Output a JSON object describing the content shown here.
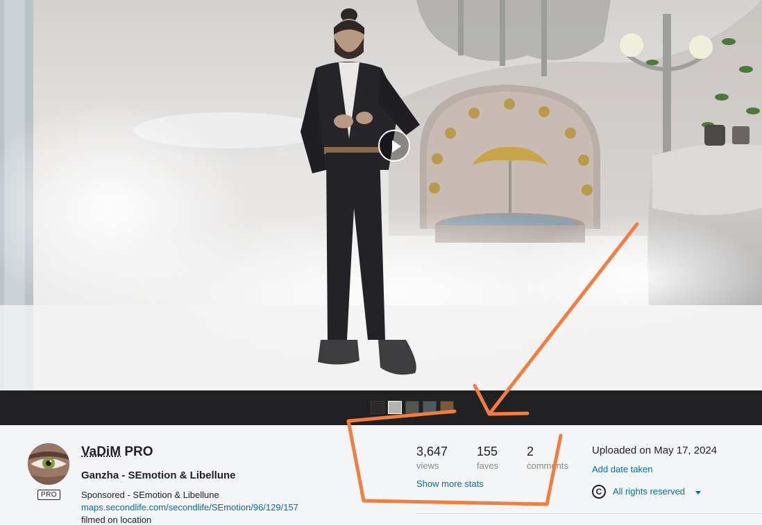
{
  "owner": {
    "name": "VaDiM",
    "badge": "PRO",
    "pro_badge": "PRO"
  },
  "photo": {
    "title": "Ganzha - SEmotion & Libellune",
    "description": {
      "line1": "Sponsored - SEmotion & Libellune",
      "link": "maps.secondlife.com/secondlife/SEmotion/96/129/157",
      "line3": "filmed on location"
    }
  },
  "stats": [
    {
      "value": "3,647",
      "label": "views"
    },
    {
      "value": "155",
      "label": "faves"
    },
    {
      "value": "2",
      "label": "comments"
    }
  ],
  "show_more_stats": "Show more stats",
  "uploaded": "Uploaded on May 17, 2024",
  "add_date_taken": "Add date taken",
  "license": {
    "icon": "C",
    "label": "All rights reserved"
  },
  "filmstrip": {
    "count": 5,
    "active_index": 1
  },
  "annotation_color": "#f47c3c"
}
